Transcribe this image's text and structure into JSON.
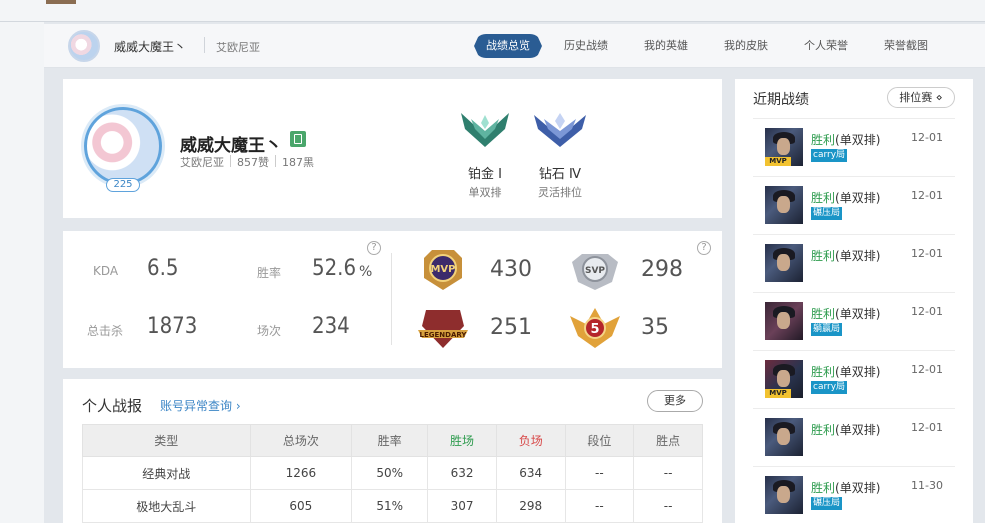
{
  "header": {
    "name": "威威大魔王丶",
    "server": "艾欧尼亚",
    "nav": [
      "战绩总览",
      "历史战绩",
      "我的英雄",
      "我的皮肤",
      "个人荣誉",
      "荣誉截图"
    ]
  },
  "profile": {
    "name": "威威大魔王丶",
    "server": "艾欧尼亚",
    "likes": "857赞",
    "blacks": "187黑",
    "level": "225",
    "ranks": [
      {
        "tier": "铂金 Ⅰ",
        "mode": "单双排",
        "color": "#2f7f6e"
      },
      {
        "tier": "钻石 Ⅳ",
        "mode": "灵活排位",
        "color": "#3e5ea8"
      }
    ]
  },
  "stats": {
    "kda_label": "KDA",
    "kda": "6.5",
    "winrate_label": "胜率",
    "winrate": "52.6",
    "winrate_unit": "%",
    "kills_label": "总击杀",
    "kills": "1873",
    "games_label": "场次",
    "games": "234",
    "medals": [
      {
        "icon": "mvp-medal",
        "text": "MVP",
        "value": "430"
      },
      {
        "icon": "svp-medal",
        "text": "SVP",
        "value": "298"
      },
      {
        "icon": "legendary-medal",
        "text": "LEGENDARY",
        "value": "251"
      },
      {
        "icon": "five-kill-medal",
        "text": "5",
        "value": "35"
      }
    ],
    "help": "?"
  },
  "report": {
    "title": "个人战报",
    "link": "账号异常查询 ›",
    "more": "更多",
    "columns": [
      "类型",
      "总场次",
      "胜率",
      "胜场",
      "负场",
      "段位",
      "胜点"
    ],
    "rows": [
      [
        "经典对战",
        "1266",
        "50%",
        "632",
        "634",
        "--",
        "--"
      ],
      [
        "极地大乱斗",
        "605",
        "51%",
        "307",
        "298",
        "--",
        "--"
      ]
    ]
  },
  "recent": {
    "title": "近期战绩",
    "filter": "排位赛 ⋄",
    "items": [
      {
        "result": "胜利",
        "mode": "(单双排)",
        "date": "12-01",
        "tag": "carry局",
        "mvp": "MVP",
        "hero": "hero"
      },
      {
        "result": "胜利",
        "mode": "(单双排)",
        "date": "12-01",
        "tag": "碾压局",
        "mvp": "",
        "hero": "hero"
      },
      {
        "result": "胜利",
        "mode": "(单双排)",
        "date": "12-01",
        "tag": "",
        "mvp": "",
        "hero": "hero"
      },
      {
        "result": "胜利",
        "mode": "(单双排)",
        "date": "12-01",
        "tag": "躺赢局",
        "mvp": "",
        "hero": "hero alt"
      },
      {
        "result": "胜利",
        "mode": "(单双排)",
        "date": "12-01",
        "tag": "carry局",
        "mvp": "MVP",
        "hero": "hero alt2"
      },
      {
        "result": "胜利",
        "mode": "(单双排)",
        "date": "12-01",
        "tag": "",
        "mvp": "",
        "hero": "hero"
      },
      {
        "result": "胜利",
        "mode": "(单双排)",
        "date": "11-30",
        "tag": "碾压局",
        "mvp": "",
        "hero": "hero"
      }
    ]
  }
}
